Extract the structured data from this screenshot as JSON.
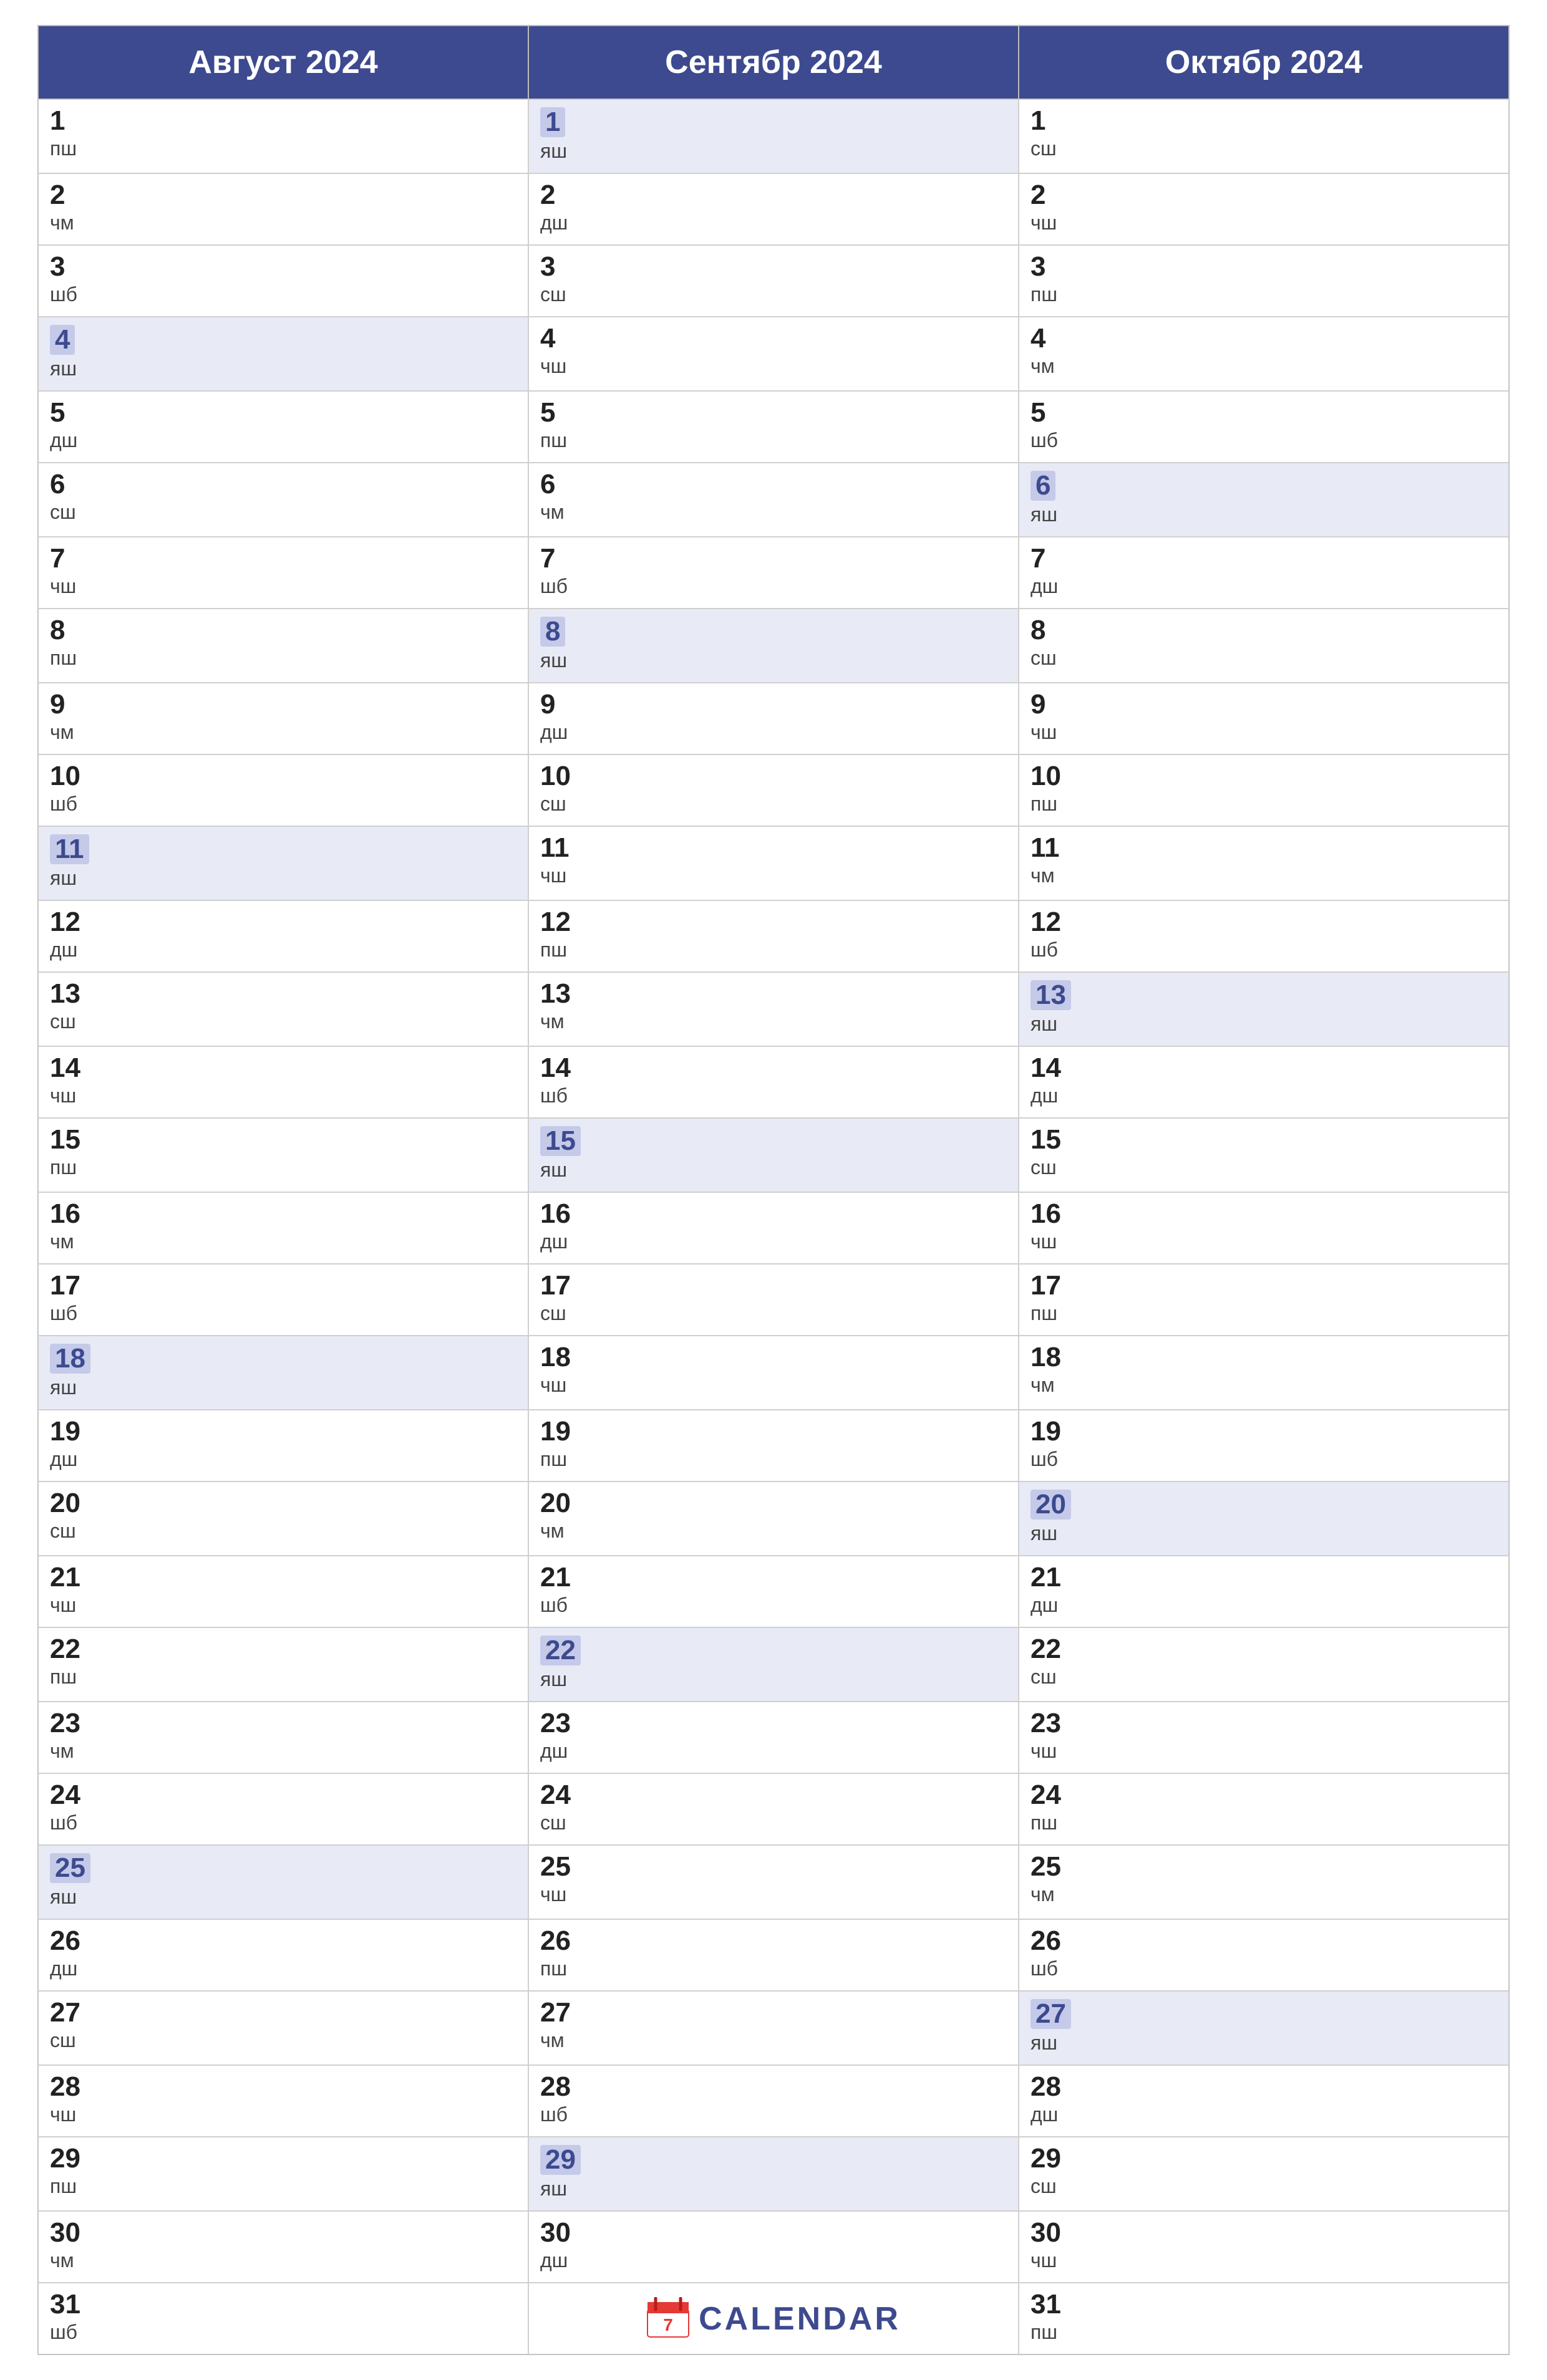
{
  "months": [
    {
      "name": "Август 2024",
      "days": [
        {
          "num": "1",
          "abbr": "пш",
          "highlight": false
        },
        {
          "num": "2",
          "abbr": "чм",
          "highlight": false
        },
        {
          "num": "3",
          "abbr": "шб",
          "highlight": false
        },
        {
          "num": "4",
          "abbr": "яш",
          "highlight": true
        },
        {
          "num": "5",
          "abbr": "дш",
          "highlight": false
        },
        {
          "num": "6",
          "abbr": "сш",
          "highlight": false
        },
        {
          "num": "7",
          "abbr": "чш",
          "highlight": false
        },
        {
          "num": "8",
          "abbr": "пш",
          "highlight": false
        },
        {
          "num": "9",
          "abbr": "чм",
          "highlight": false
        },
        {
          "num": "10",
          "abbr": "шб",
          "highlight": false
        },
        {
          "num": "11",
          "abbr": "яш",
          "highlight": true
        },
        {
          "num": "12",
          "abbr": "дш",
          "highlight": false
        },
        {
          "num": "13",
          "abbr": "сш",
          "highlight": false
        },
        {
          "num": "14",
          "abbr": "чш",
          "highlight": false
        },
        {
          "num": "15",
          "abbr": "пш",
          "highlight": false
        },
        {
          "num": "16",
          "abbr": "чм",
          "highlight": false
        },
        {
          "num": "17",
          "abbr": "шб",
          "highlight": false
        },
        {
          "num": "18",
          "abbr": "яш",
          "highlight": true
        },
        {
          "num": "19",
          "abbr": "дш",
          "highlight": false
        },
        {
          "num": "20",
          "abbr": "сш",
          "highlight": false
        },
        {
          "num": "21",
          "abbr": "чш",
          "highlight": false
        },
        {
          "num": "22",
          "abbr": "пш",
          "highlight": false
        },
        {
          "num": "23",
          "abbr": "чм",
          "highlight": false
        },
        {
          "num": "24",
          "abbr": "шб",
          "highlight": false
        },
        {
          "num": "25",
          "abbr": "яш",
          "highlight": true
        },
        {
          "num": "26",
          "abbr": "дш",
          "highlight": false
        },
        {
          "num": "27",
          "abbr": "сш",
          "highlight": false
        },
        {
          "num": "28",
          "abbr": "чш",
          "highlight": false
        },
        {
          "num": "29",
          "abbr": "пш",
          "highlight": false
        },
        {
          "num": "30",
          "abbr": "чм",
          "highlight": false
        },
        {
          "num": "31",
          "abbr": "шб",
          "highlight": false
        }
      ]
    },
    {
      "name": "Сентябр 2024",
      "days": [
        {
          "num": "1",
          "abbr": "яш",
          "highlight": true
        },
        {
          "num": "2",
          "abbr": "дш",
          "highlight": false
        },
        {
          "num": "3",
          "abbr": "сш",
          "highlight": false
        },
        {
          "num": "4",
          "abbr": "чш",
          "highlight": false
        },
        {
          "num": "5",
          "abbr": "пш",
          "highlight": false
        },
        {
          "num": "6",
          "abbr": "чм",
          "highlight": false
        },
        {
          "num": "7",
          "abbr": "шб",
          "highlight": false
        },
        {
          "num": "8",
          "abbr": "яш",
          "highlight": true
        },
        {
          "num": "9",
          "abbr": "дш",
          "highlight": false
        },
        {
          "num": "10",
          "abbr": "сш",
          "highlight": false
        },
        {
          "num": "11",
          "abbr": "чш",
          "highlight": false
        },
        {
          "num": "12",
          "abbr": "пш",
          "highlight": false
        },
        {
          "num": "13",
          "abbr": "чм",
          "highlight": false
        },
        {
          "num": "14",
          "abbr": "шб",
          "highlight": false
        },
        {
          "num": "15",
          "abbr": "яш",
          "highlight": true
        },
        {
          "num": "16",
          "abbr": "дш",
          "highlight": false
        },
        {
          "num": "17",
          "abbr": "сш",
          "highlight": false
        },
        {
          "num": "18",
          "abbr": "чш",
          "highlight": false
        },
        {
          "num": "19",
          "abbr": "пш",
          "highlight": false
        },
        {
          "num": "20",
          "abbr": "чм",
          "highlight": false
        },
        {
          "num": "21",
          "abbr": "шб",
          "highlight": false
        },
        {
          "num": "22",
          "abbr": "яш",
          "highlight": true
        },
        {
          "num": "23",
          "abbr": "дш",
          "highlight": false
        },
        {
          "num": "24",
          "abbr": "сш",
          "highlight": false
        },
        {
          "num": "25",
          "abbr": "чш",
          "highlight": false
        },
        {
          "num": "26",
          "abbr": "пш",
          "highlight": false
        },
        {
          "num": "27",
          "abbr": "чм",
          "highlight": false
        },
        {
          "num": "28",
          "abbr": "шб",
          "highlight": false
        },
        {
          "num": "29",
          "abbr": "яш",
          "highlight": true
        },
        {
          "num": "30",
          "abbr": "дш",
          "highlight": false
        }
      ]
    },
    {
      "name": "Октябр 2024",
      "days": [
        {
          "num": "1",
          "abbr": "сш",
          "highlight": false
        },
        {
          "num": "2",
          "abbr": "чш",
          "highlight": false
        },
        {
          "num": "3",
          "abbr": "пш",
          "highlight": false
        },
        {
          "num": "4",
          "abbr": "чм",
          "highlight": false
        },
        {
          "num": "5",
          "abbr": "шб",
          "highlight": false
        },
        {
          "num": "6",
          "abbr": "яш",
          "highlight": true
        },
        {
          "num": "7",
          "abbr": "дш",
          "highlight": false
        },
        {
          "num": "8",
          "abbr": "сш",
          "highlight": false
        },
        {
          "num": "9",
          "abbr": "чш",
          "highlight": false
        },
        {
          "num": "10",
          "abbr": "пш",
          "highlight": false
        },
        {
          "num": "11",
          "abbr": "чм",
          "highlight": false
        },
        {
          "num": "12",
          "abbr": "шб",
          "highlight": false
        },
        {
          "num": "13",
          "abbr": "яш",
          "highlight": true
        },
        {
          "num": "14",
          "abbr": "дш",
          "highlight": false
        },
        {
          "num": "15",
          "abbr": "сш",
          "highlight": false
        },
        {
          "num": "16",
          "abbr": "чш",
          "highlight": false
        },
        {
          "num": "17",
          "abbr": "пш",
          "highlight": false
        },
        {
          "num": "18",
          "abbr": "чм",
          "highlight": false
        },
        {
          "num": "19",
          "abbr": "шб",
          "highlight": false
        },
        {
          "num": "20",
          "abbr": "яш",
          "highlight": true
        },
        {
          "num": "21",
          "abbr": "дш",
          "highlight": false
        },
        {
          "num": "22",
          "abbr": "сш",
          "highlight": false
        },
        {
          "num": "23",
          "abbr": "чш",
          "highlight": false
        },
        {
          "num": "24",
          "abbr": "пш",
          "highlight": false
        },
        {
          "num": "25",
          "abbr": "чм",
          "highlight": false
        },
        {
          "num": "26",
          "abbr": "шб",
          "highlight": false
        },
        {
          "num": "27",
          "abbr": "яш",
          "highlight": true
        },
        {
          "num": "28",
          "abbr": "дш",
          "highlight": false
        },
        {
          "num": "29",
          "abbr": "сш",
          "highlight": false
        },
        {
          "num": "30",
          "abbr": "чш",
          "highlight": false
        },
        {
          "num": "31",
          "abbr": "пш",
          "highlight": false
        }
      ]
    }
  ],
  "logo": {
    "text": "CALENDAR"
  }
}
